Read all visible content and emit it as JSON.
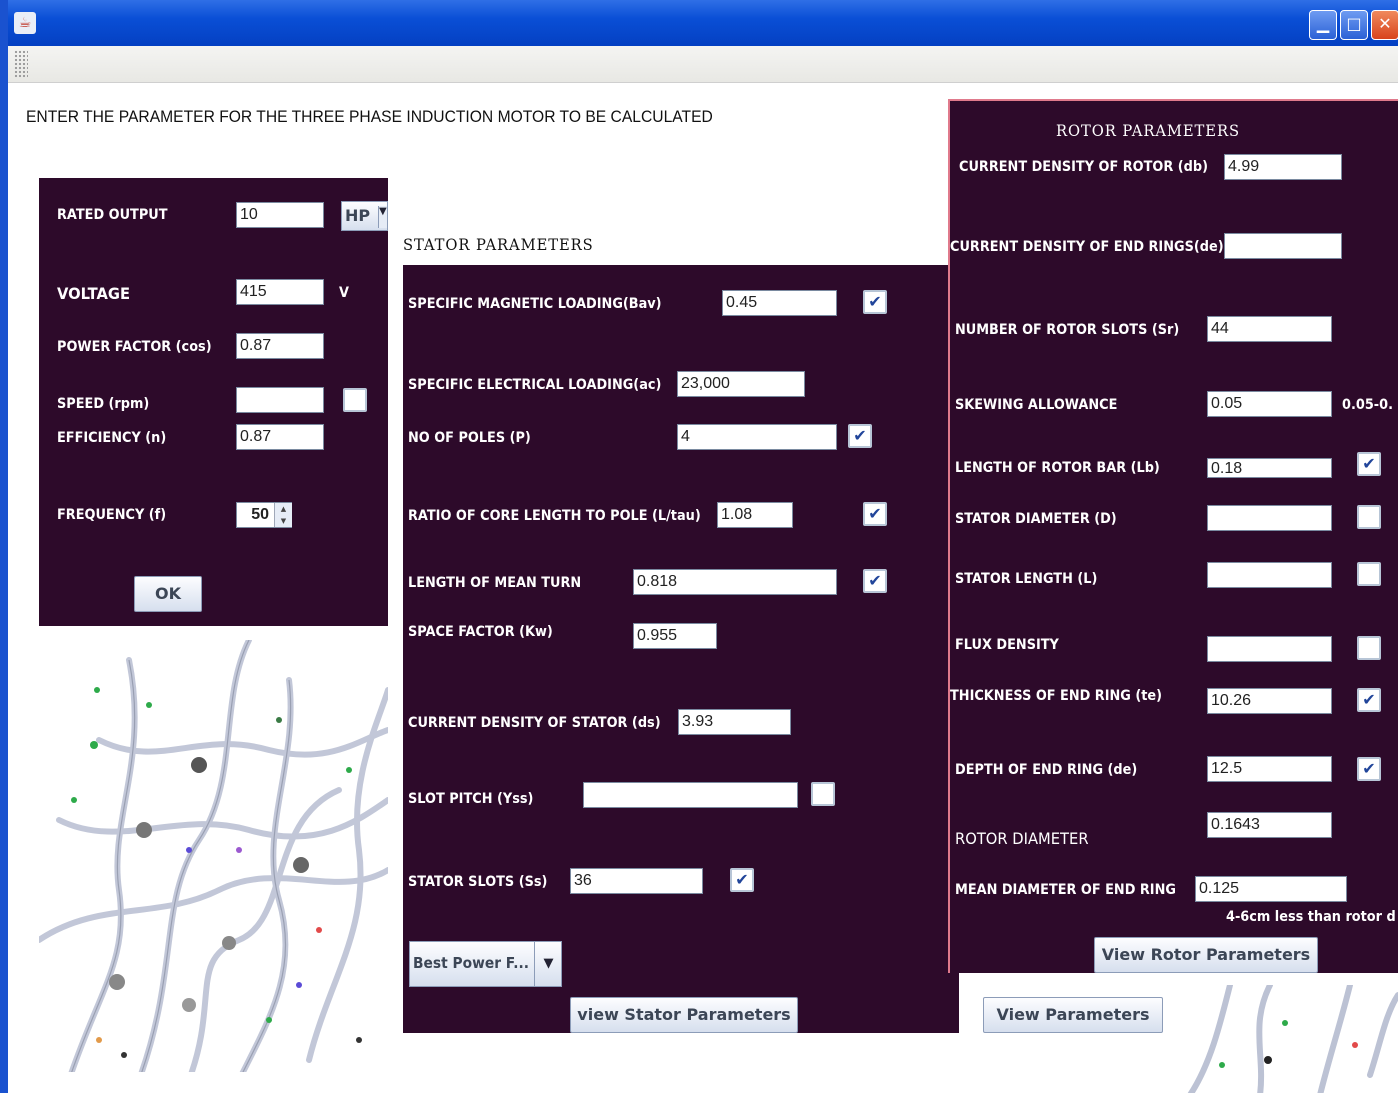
{
  "window": {
    "app_icon": "java-cup-icon",
    "minimize_icon": "minimize-icon",
    "maximize_icon": "maximize-icon",
    "close_icon": "close-icon"
  },
  "heading": "ENTER THE PARAMETER FOR THE THREE PHASE INDUCTION MOTOR TO BE CALCULATED",
  "input_panel": {
    "rated_output_label": "RATED OUTPUT",
    "rated_output_value": "10",
    "unit_select_value": "HP",
    "voltage_label": "VOLTAGE",
    "voltage_value": "415",
    "voltage_unit": "V",
    "power_factor_label": "POWER FACTOR (cos)",
    "power_factor_value": "0.87",
    "speed_label": "SPEED (rpm)",
    "speed_value": "",
    "efficiency_label": "EFFICIENCY (n)",
    "efficiency_value": "0.87",
    "frequency_label": "FREQUENCY (f)",
    "frequency_value": "50",
    "ok_label": "OK"
  },
  "stator": {
    "title": "STATOR PARAMETERS",
    "bav_label": "SPECIFIC MAGNETIC LOADING(Bav)",
    "bav_value": "0.45",
    "ac_label": "SPECIFIC ELECTRICAL LOADING(ac)",
    "ac_value": "23,000",
    "poles_label": "NO OF POLES (P)",
    "poles_value": "4",
    "ratio_label": "RATIO OF CORE LENGTH TO POLE (L/tau)",
    "ratio_value": "1.08",
    "mean_turn_label": "LENGTH OF MEAN TURN",
    "mean_turn_value": "0.818",
    "kw_label": "SPACE FACTOR (Kw)",
    "kw_value": "0.955",
    "ds_label": "CURRENT DENSITY OF STATOR (ds)",
    "ds_value": "3.93",
    "yss_label": "SLOT PITCH (Yss)",
    "yss_value": "",
    "ss_label": "STATOR SLOTS (Ss)",
    "ss_value": "36",
    "combo_value": "Best Power F...",
    "view_button": "view Stator Parameters"
  },
  "rotor": {
    "title": "ROTOR PARAMETERS",
    "db_label": "CURRENT DENSITY OF ROTOR (db)",
    "db_value": "4.99",
    "de_rings_label": "CURRENT DENSITY OF END RINGS(de)",
    "de_rings_value": "",
    "sr_label": "NUMBER OF ROTOR SLOTS (Sr)",
    "sr_value": "44",
    "skew_label": "SKEWING ALLOWANCE",
    "skew_value": "0.05",
    "skew_hint": "0.05-0.",
    "lb_label": "LENGTH OF ROTOR BAR (Lb)",
    "lb_value": "0.18",
    "d_label": "STATOR DIAMETER (D)",
    "d_value": "",
    "l_label": "STATOR LENGTH (L)",
    "l_value": "",
    "flux_label": "FLUX DENSITY",
    "flux_value": "",
    "te_label": "THICKNESS OF END RING (te)",
    "te_value": "10.26",
    "depth_label": "DEPTH OF END RING (de)",
    "depth_value": "12.5",
    "rotor_diam_label": "ROTOR DIAMETER",
    "rotor_diam_value": "0.1643",
    "mean_diam_label": "MEAN DIAMETER OF END RING",
    "mean_diam_value": "0.125",
    "mean_diam_hint": "4-6cm less than rotor d",
    "view_button": "View Rotor Parameters"
  },
  "view_parameters_button": "View Parameters"
}
